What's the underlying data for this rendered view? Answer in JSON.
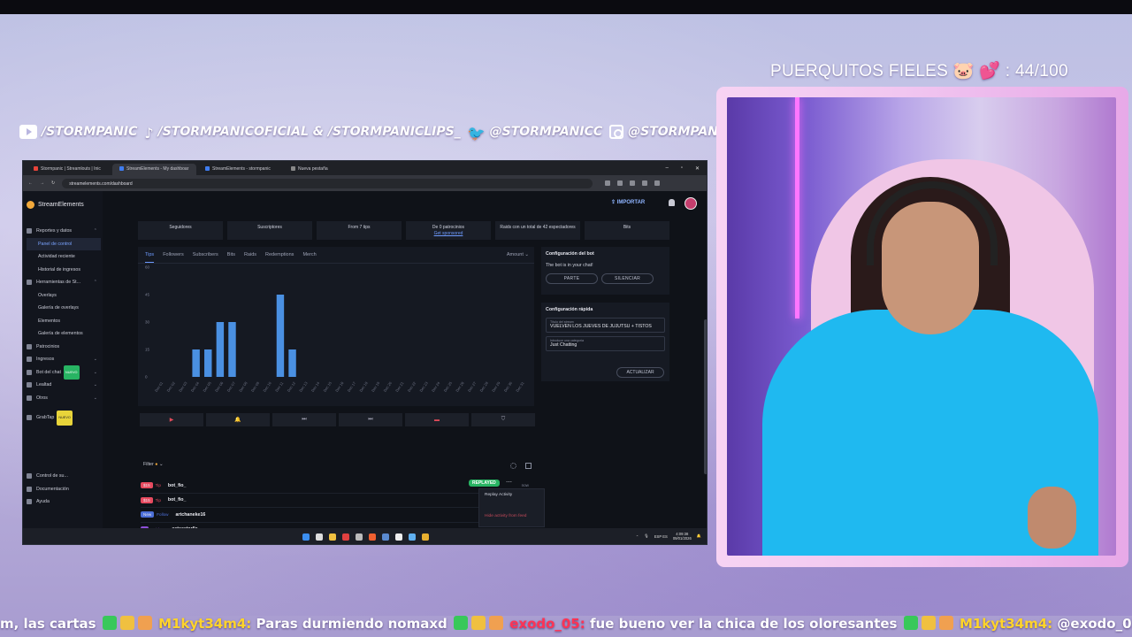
{
  "overlay": {
    "goal_text": "PUERQUITOS FIELES 🐷 💕 : 44/100",
    "socials": [
      {
        "icon": "youtube-icon",
        "handle": "/STORMPANIC"
      },
      {
        "icon": "tiktok-icon",
        "handle": "/STORMPANICOFICIAL & /STORMPANICLIPS_"
      },
      {
        "icon": "twitter-icon",
        "handle": "@STORMPANICC"
      },
      {
        "icon": "instagram-icon",
        "handle": "@STORMPANIC"
      }
    ],
    "chat_ticker": [
      {
        "text": "m, las cartas",
        "user": false
      },
      {
        "text": "M1kyt34m4:",
        "user": true,
        "color": "#ffd42a"
      },
      {
        "text": "Paras durmiendo nomaxd",
        "user": false
      },
      {
        "text": "exodo_05:",
        "user": true,
        "color": "#ff3355"
      },
      {
        "text": "fue bueno ver la chica de los oloresantes",
        "user": false
      },
      {
        "text": "M1kyt34m4:",
        "user": true,
        "color": "#ffd42a"
      },
      {
        "text": "@exodo_05",
        "user": false
      }
    ]
  },
  "browser": {
    "tabs": [
      "Stormpanic | Streamlouts | Inic",
      "StreamElements - My dashboar",
      "StreamElements - stormpanic",
      "Nueva pestaña"
    ],
    "url": "streamelements.com/dashboard"
  },
  "dashboard": {
    "brand": "StreamElements",
    "import_label": "IMPORTAR",
    "sidebar": [
      {
        "label": "Reportes y datos",
        "level": 0,
        "chev": "⌃"
      },
      {
        "label": "Panel de control",
        "level": 1,
        "selected": true
      },
      {
        "label": "Actividad reciente",
        "level": 1
      },
      {
        "label": "Historial de ingresos",
        "level": 1
      },
      {
        "label": "Herramientas de St...",
        "level": 0,
        "chev": "⌃"
      },
      {
        "label": "Overlays",
        "level": 1
      },
      {
        "label": "Galería de overlays",
        "level": 1
      },
      {
        "label": "Elementos",
        "level": 1
      },
      {
        "label": "Galería de elementos",
        "level": 1
      },
      {
        "label": "Patrocinios",
        "level": 0
      },
      {
        "label": "Ingresos",
        "level": 0,
        "chev": "⌄"
      },
      {
        "label": "Bot del chat",
        "level": 0,
        "chev": "⌄",
        "badge": "NUEVO"
      },
      {
        "label": "Lealtad",
        "level": 0,
        "chev": "⌄"
      },
      {
        "label": "Otros",
        "level": 0,
        "chev": "⌄"
      },
      {
        "label": "",
        "level": 0,
        "spacer": true
      },
      {
        "label": "GrabTap",
        "level": 0,
        "badge": "NUEVO"
      }
    ],
    "sidebar_bottom": [
      "Control de su...",
      "Documentación",
      "Ayuda"
    ],
    "stats": [
      {
        "text": "Seguidores"
      },
      {
        "text": "Suscriptores"
      },
      {
        "text": "From 7 tips"
      },
      {
        "text": "De 0 patrocinios",
        "link": "Get sponsored"
      },
      {
        "text": "Raids con un total de 42 espectadores"
      },
      {
        "text": "Bits"
      }
    ],
    "chart_tabs": [
      "Tips",
      "Followers",
      "Subscribers",
      "Bits",
      "Raids",
      "Redemptions",
      "Merch"
    ],
    "amount_label": "Amount",
    "filter_label": "Filter",
    "replayed_label": "REPLAYED",
    "popup": {
      "replay": "Replay Activity",
      "hide": "Hide activity from feed"
    },
    "feed": [
      {
        "badge": "$15",
        "type": "Tip",
        "name": "bot_fio_",
        "badge_color": "#e84a5f",
        "time": "now"
      },
      {
        "badge": "$15",
        "type": "Tip",
        "name": "bot_fio_",
        "badge_color": "#e84a5f",
        "time": ""
      },
      {
        "badge": "New",
        "type": "Follow",
        "name": "artchaneke16",
        "badge_color": "#4c6fd8",
        "time": ""
      },
      {
        "badge": "7",
        "type": "Raiders",
        "name": "astaastarlla",
        "badge_color": "#8e4fd8",
        "time": ""
      },
      {
        "badge": "6",
        "type": "Raiders",
        "name": "Neexs22",
        "badge_color": "#8e4fd8",
        "time": "1h"
      },
      {
        "badge": "New",
        "type": "Follow",
        "name": "ToniSmart",
        "badge_color": "#4c6fd8",
        "time": "2h"
      }
    ],
    "bot_config": {
      "title": "Configuración del bot",
      "status": "The bot is in your chat!",
      "part_label": "PARTE",
      "mute_label": "SILENCIAR"
    },
    "quick_config": {
      "title": "Configuración rápida",
      "title_field_label": "Título del stream",
      "title_field_value": "VUELVEN LOS JUEVES DE JUJUTSU + TISTOS",
      "category_field_label": "Introduce una categoría",
      "category_field_value": "Just Chatting",
      "update_label": "ACTUALIZAR"
    },
    "taskbar": {
      "lang": "ESP ES",
      "time": "4:09:38",
      "date": "09/01/2026"
    }
  },
  "chart_data": {
    "type": "bar",
    "categories": [
      "Dec 01",
      "Dec 02",
      "Dec 03",
      "Dec 04",
      "Dec 05",
      "Dec 06",
      "Dec 07",
      "Dec 08",
      "Dec 09",
      "Dec 10",
      "Dec 11",
      "Dec 12",
      "Dec 13",
      "Dec 14",
      "Dec 15",
      "Dec 16",
      "Dec 17",
      "Dec 18",
      "Dec 19",
      "Dec 20",
      "Dec 21",
      "Dec 22",
      "Dec 23",
      "Dec 24",
      "Dec 25",
      "Dec 26",
      "Dec 27",
      "Dec 28",
      "Dec 29",
      "Dec 30",
      "Dec 31"
    ],
    "values": [
      0,
      0,
      0,
      15,
      15,
      30,
      30,
      0,
      0,
      0,
      45,
      15,
      0,
      0,
      0,
      0,
      0,
      0,
      0,
      0,
      0,
      0,
      0,
      0,
      0,
      0,
      0,
      0,
      0,
      0,
      0
    ],
    "yticks": [
      0,
      15,
      30,
      45,
      60
    ],
    "ylim": [
      0,
      60
    ],
    "bar_color": "#4a90e2"
  }
}
